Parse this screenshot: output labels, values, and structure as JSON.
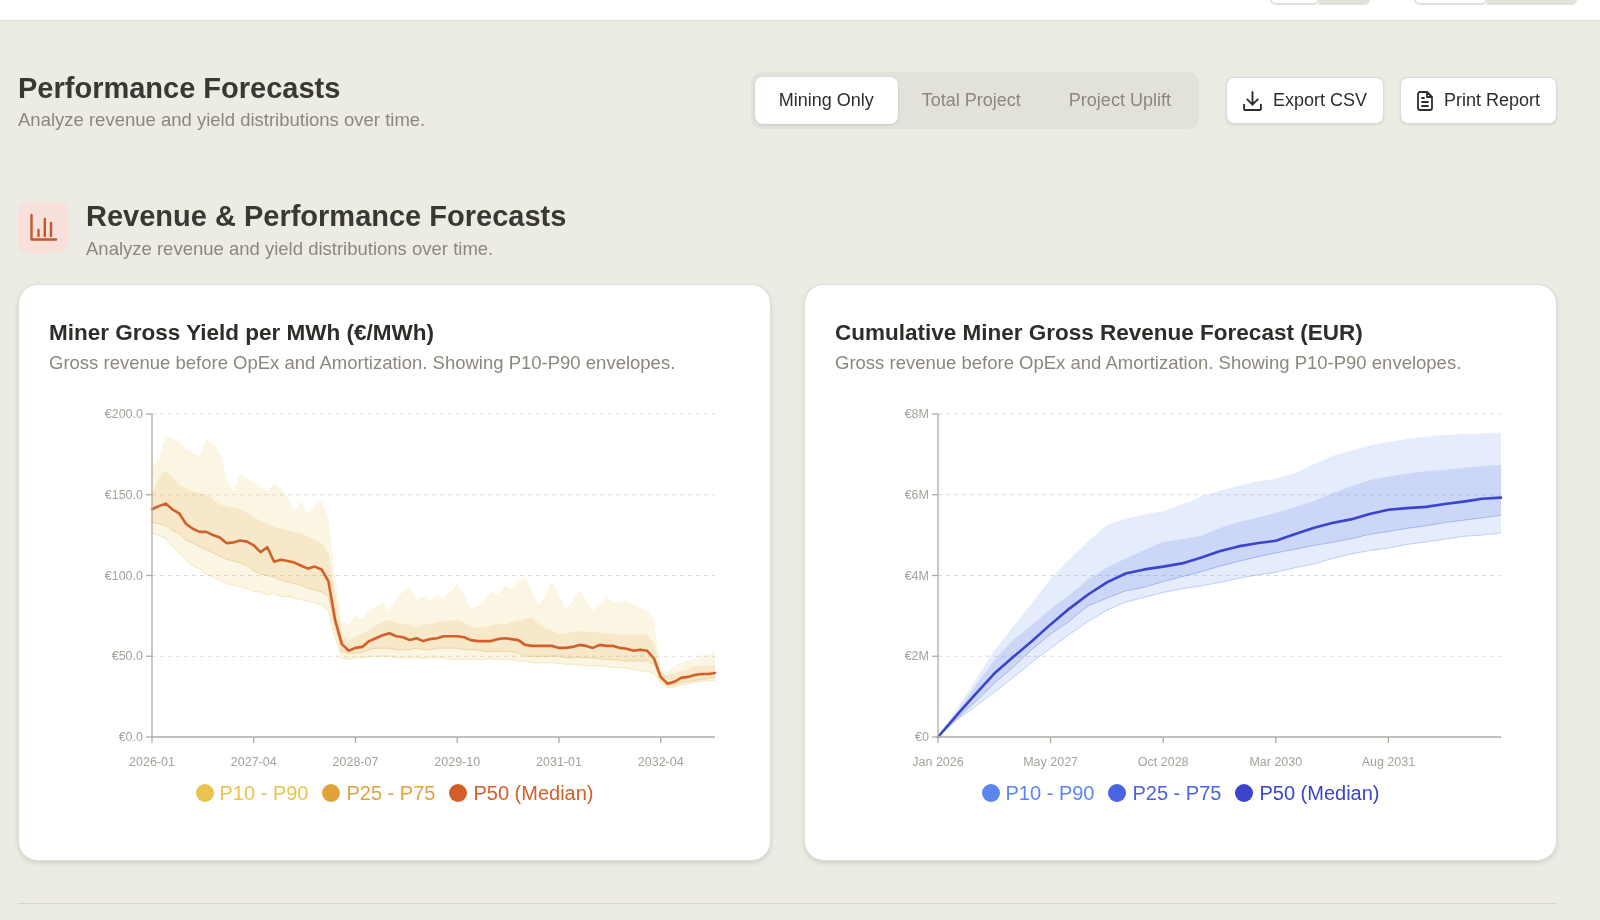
{
  "header_toggles": [
    {
      "segments": [
        {
          "selected": true
        },
        {
          "selected": false
        }
      ]
    },
    {
      "segments": [
        {
          "selected": true
        },
        {
          "selected": false
        }
      ]
    }
  ],
  "page": {
    "title": "Performance Forecasts",
    "subtitle": "Analyze revenue and yield distributions over time."
  },
  "view_tabs": [
    {
      "label": "Mining Only",
      "selected": true
    },
    {
      "label": "Total Project",
      "selected": false
    },
    {
      "label": "Project Uplift",
      "selected": false
    }
  ],
  "actions": [
    {
      "label": "Export CSV",
      "kind": "export"
    },
    {
      "label": "Print Report",
      "kind": "print"
    }
  ],
  "section": {
    "title": "Revenue & Performance Forecasts",
    "subtitle": "Analyze revenue and yield distributions over time."
  },
  "cards": [
    {
      "subtitle": "Gross revenue before OpEx and Amortization. Showing P10-P90 envelopes.",
      "chart_data": {
        "type": "area",
        "title": "Miner Gross Yield per MWh (€/MWh)",
        "grid": true,
        "legend": "bottom",
        "categories": [
          "2026-01",
          null,
          null,
          null,
          null,
          null,
          null,
          null,
          null,
          null,
          null,
          null,
          null,
          null,
          null,
          "2027-04",
          null,
          null,
          null,
          null,
          null,
          null,
          null,
          null,
          null,
          null,
          null,
          null,
          null,
          null,
          "2028-07",
          null,
          null,
          null,
          null,
          null,
          null,
          null,
          null,
          null,
          null,
          null,
          null,
          null,
          null,
          "2029-10",
          null,
          null,
          null,
          null,
          null,
          null,
          null,
          null,
          null,
          null,
          null,
          null,
          null,
          null,
          "2031-01",
          null,
          null,
          null,
          null,
          null,
          null,
          null,
          null,
          null,
          null,
          null,
          null,
          null,
          null,
          "2032-04",
          null,
          null,
          null,
          null,
          null,
          null,
          null,
          null
        ],
        "ylim": [
          0,
          200
        ],
        "yticks": [
          {
            "value": 0,
            "label": "€0.0"
          },
          {
            "value": 50,
            "label": "€50.0"
          },
          {
            "value": 100,
            "label": "€100.0"
          },
          {
            "value": 150,
            "label": "€150.0"
          },
          {
            "value": 200,
            "label": "€200.0"
          }
        ],
        "series": [
          {
            "name": "P10 - P90",
            "color": "#e8c44e",
            "values": [
              168,
              172,
              186,
              185,
              183,
              178,
              176,
              174,
              184,
              182,
              176,
              160,
              152,
              163,
              160,
              158,
              155,
              152,
              157,
              154,
              148,
              140,
              146,
              138,
              144,
              146,
              136,
              98,
              72,
              70,
              75,
              73,
              78,
              81,
              83,
              78,
              86,
              90,
              93,
              85,
              87,
              84,
              88,
              86,
              90,
              95,
              88,
              80,
              81.5,
              85,
              90,
              88,
              93.5,
              92,
              96,
              99.5,
              90,
              81.5,
              88,
              96.5,
              88,
              78.5,
              84,
              90.5,
              85,
              78.5,
              82,
              86,
              84,
              83,
              84.5,
              82,
              80,
              78.5,
              72.5,
              42.6,
              40,
              44,
              46,
              47.5,
              48.6,
              50,
              51,
              53
            ]
          },
          {
            "type": "line",
            "color": "#e8c44e",
            "values": [
              126,
              125,
              123,
              118,
              114,
              110,
              106,
              104,
              101,
              99,
              97,
              95,
              94,
              93,
              92,
              90,
              90,
              88,
              89,
              87,
              87,
              86,
              85,
              84,
              83,
              82,
              78,
              62,
              49,
              48,
              49,
              49,
              50,
              50,
              50,
              50,
              49,
              49,
              49,
              49,
              48.6,
              49,
              49,
              49,
              48,
              48,
              48,
              48,
              48,
              48,
              48.6,
              48,
              48,
              48,
              47,
              47,
              46,
              46,
              46,
              46,
              45.6,
              45,
              45,
              45,
              44,
              44,
              44,
              43.5,
              43,
              43,
              42.6,
              42,
              41,
              40.5,
              39.6,
              33.6,
              30.6,
              31,
              32,
              33,
              34,
              34.5,
              34.8,
              34.8
            ]
          },
          {
            "name": "P25 - P75",
            "color": "#e0a33c",
            "values": [
              150,
              160,
              165,
              161,
              156,
              154,
              152,
              151,
              150,
              147,
              144,
              143,
              142,
              141,
              139,
              136,
              134,
              132,
              130,
              129,
              128,
              127,
              126,
              124,
              122,
              120,
              114,
              90,
              63,
              60,
              62,
              64,
              66,
              69,
              71,
              72.5,
              71,
              70,
              69,
              68,
              69.5,
              70,
              71,
              72,
              72,
              72.5,
              71,
              68,
              68,
              68,
              69,
              70,
              69.5,
              71,
              72,
              73,
              74,
              70,
              67,
              66,
              63.5,
              64,
              65,
              65.5,
              65,
              65,
              64.5,
              64,
              64,
              63.5,
              63.5,
              63.5,
              63.5,
              63.5,
              57.5,
              39.6,
              38,
              39.6,
              41,
              42,
              44,
              44,
              44,
              44
            ]
          },
          {
            "type": "line",
            "color": "#e0a33c",
            "values": [
              133,
              132,
              131,
              128,
              126,
              122,
              120,
              118,
              116,
              114,
              112,
              110,
              109,
              108,
              106,
              103,
              101,
              100,
              99,
              97,
              96,
              95,
              94,
              92,
              91,
              90,
              87,
              68,
              53,
              51.5,
              52,
              52.5,
              54,
              55,
              55,
              55,
              54,
              54,
              54,
              55,
              54,
              54,
              55,
              55,
              55,
              55,
              54,
              54,
              54,
              53,
              53,
              53,
              53,
              53,
              52,
              50,
              50,
              50,
              50,
              50,
              50,
              49,
              49,
              49.5,
              49,
              49,
              48.5,
              48,
              48,
              47.5,
              47,
              47,
              47,
              47,
              45,
              35,
              31.8,
              32.5,
              33.5,
              34.5,
              35,
              35.8,
              36.2,
              36.6
            ]
          },
          {
            "name": "P50 (Median)",
            "color": "#d35f28",
            "type": "line",
            "values": [
              141,
              143,
              144.5,
              141,
              138.5,
              132,
              129,
              127,
              127,
              125,
              123.5,
              120,
              120.5,
              121.7,
              121,
              118.7,
              114.5,
              117.5,
              108.5,
              109.7,
              109,
              108,
              106,
              104.3,
              105.5,
              103.7,
              96.5,
              72.5,
              57.5,
              53.4,
              55.2,
              55.8,
              59.4,
              61.2,
              63,
              64.2,
              62.4,
              61.8,
              60,
              61.2,
              59.4,
              60.6,
              61.2,
              62.4,
              62.4,
              62.4,
              61.8,
              60,
              59.4,
              59.4,
              59.4,
              60.6,
              61.2,
              60.6,
              60,
              57,
              56.4,
              56.4,
              56.4,
              56.4,
              55.2,
              55.2,
              55.8,
              57,
              56.4,
              55.2,
              57,
              56.4,
              56.4,
              55.2,
              54.6,
              53.4,
              54,
              53.4,
              48.6,
              37.2,
              33,
              34.2,
              36.6,
              37.2,
              38.4,
              39,
              39,
              39.6
            ]
          }
        ]
      }
    },
    {
      "subtitle": "Gross revenue before OpEx and Amortization. Showing P10-P90 envelopes.",
      "chart_data": {
        "type": "area",
        "title": "Cumulative Miner Gross Revenue Forecast (EUR)",
        "grid": true,
        "legend": "bottom",
        "categories": [
          "Jan 2026",
          null,
          null,
          null,
          null,
          null,
          "May 2027",
          null,
          null,
          null,
          null,
          null,
          "Oct 2028",
          null,
          null,
          null,
          null,
          null,
          "Mar 2030",
          null,
          null,
          null,
          null,
          null,
          "Aug 2031",
          null,
          null,
          null,
          null,
          null,
          null
        ],
        "ylim": [
          0,
          8
        ],
        "yticks": [
          {
            "value": 0,
            "label": "€0"
          },
          {
            "value": 2,
            "label": "€2M"
          },
          {
            "value": 4,
            "label": "€4M"
          },
          {
            "value": 6,
            "label": "€6M"
          },
          {
            "value": 8,
            "label": "€8M"
          }
        ],
        "series": [
          {
            "name": "P10 - P90",
            "color": "#5b86ee",
            "values": [
              0,
              0.69,
              1.41,
              2.14,
              2.73,
              3.31,
              3.92,
              4.4,
              4.84,
              5.25,
              5.41,
              5.51,
              5.59,
              5.76,
              5.95,
              6.1,
              6.22,
              6.33,
              6.4,
              6.53,
              6.75,
              6.96,
              7.09,
              7.22,
              7.31,
              7.38,
              7.44,
              7.48,
              7.51,
              7.52,
              7.54
            ]
          },
          {
            "type": "line",
            "color": "#5b86ee",
            "values": [
              0,
              0.42,
              0.76,
              1.11,
              1.47,
              1.85,
              2.2,
              2.54,
              2.86,
              3.14,
              3.34,
              3.46,
              3.58,
              3.67,
              3.74,
              3.83,
              3.93,
              4.01,
              4.08,
              4.19,
              4.28,
              4.42,
              4.53,
              4.62,
              4.68,
              4.77,
              4.83,
              4.9,
              4.97,
              5.0,
              5.05
            ]
          },
          {
            "name": "P25 - P75",
            "color": "#4a63e0",
            "values": [
              0,
              0.61,
              1.27,
              1.9,
              2.41,
              2.77,
              3.17,
              3.52,
              3.9,
              4.2,
              4.42,
              4.63,
              4.83,
              4.9,
              4.98,
              5.17,
              5.32,
              5.43,
              5.55,
              5.69,
              5.84,
              6.03,
              6.21,
              6.36,
              6.45,
              6.52,
              6.58,
              6.62,
              6.66,
              6.71,
              6.74
            ]
          },
          {
            "type": "line",
            "color": "#4a63e0",
            "values": [
              0,
              0.46,
              0.87,
              1.33,
              1.73,
              2.17,
              2.55,
              2.87,
              3.25,
              3.44,
              3.62,
              3.71,
              3.85,
              3.97,
              4.09,
              4.23,
              4.35,
              4.46,
              4.56,
              4.65,
              4.74,
              4.82,
              4.91,
              5.02,
              5.09,
              5.17,
              5.23,
              5.31,
              5.37,
              5.43,
              5.49
            ]
          },
          {
            "name": "P50 (Median)",
            "color": "#3a44cc",
            "type": "line",
            "values": [
              0,
              0.54,
              1.06,
              1.57,
              1.98,
              2.37,
              2.79,
              3.18,
              3.53,
              3.83,
              4.05,
              4.15,
              4.22,
              4.3,
              4.44,
              4.6,
              4.72,
              4.8,
              4.86,
              5.02,
              5.18,
              5.3,
              5.39,
              5.52,
              5.63,
              5.67,
              5.7,
              5.77,
              5.83,
              5.9,
              5.93
            ]
          }
        ]
      }
    }
  ]
}
